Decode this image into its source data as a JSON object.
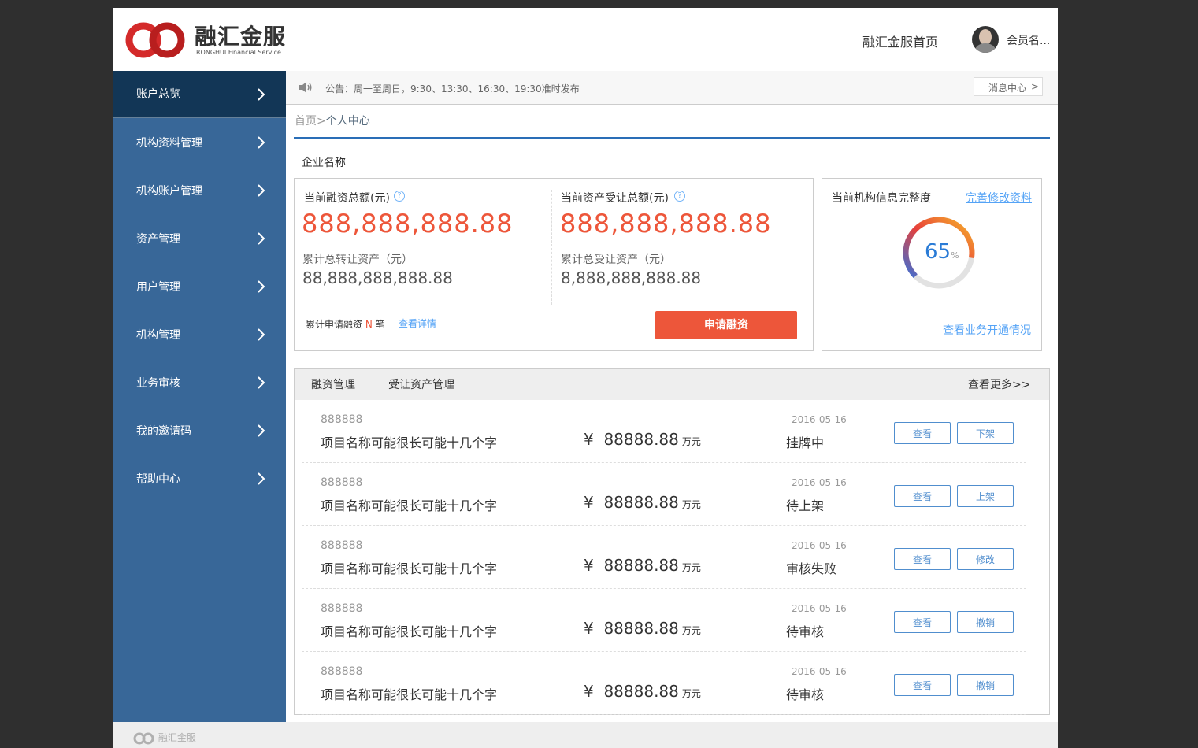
{
  "header": {
    "logo_cn": "融汇金服",
    "logo_en": "RONGHUI Financial Service",
    "home_link": "融汇金服首页",
    "username": "会员名..."
  },
  "sidebar": {
    "items": [
      {
        "label": "账户总览",
        "active": true
      },
      {
        "label": "机构资料管理"
      },
      {
        "label": "机构账户管理"
      },
      {
        "label": "资产管理"
      },
      {
        "label": "用户管理"
      },
      {
        "label": "机构管理"
      },
      {
        "label": "业务审核"
      },
      {
        "label": "我的邀请码"
      },
      {
        "label": "帮助中心"
      }
    ]
  },
  "notice": {
    "text": "公告：周一至周日，9:30、13:30、16:30、19:30准时发布",
    "message_center": "消息中心",
    "arrow": ">"
  },
  "breadcrumb": {
    "home": "首页",
    "sep": ">",
    "current": "个人中心"
  },
  "company": "企业名称",
  "summary": {
    "financing_total_label": "当前融资总额(元)",
    "financing_total_value": "888,888,888.88",
    "asset_total_label": "当前资产受让总额(元)",
    "asset_total_value": "888,888,888.88",
    "cum_transfer_label": "累计总转让资产（元）",
    "cum_transfer_value": "88,888,888,888.88",
    "cum_receive_label": "累计总受让资产（元）",
    "cum_receive_value": "8,888,888,888.88",
    "apply_count_prefix": "累计申请融资",
    "apply_count_n": "N",
    "apply_count_suffix": "笔",
    "view_detail": "查看详情",
    "apply_button": "申请融资",
    "q_mark": "?"
  },
  "completeness": {
    "title": "当前机构信息完整度",
    "edit_link": "完善修改资料",
    "percent": 65,
    "percent_text": "65",
    "percent_sign": "%",
    "business_link": "查看业务开通情况",
    "accent": "#54a3f6"
  },
  "tabs": {
    "items": [
      "融资管理",
      "受让资产管理"
    ],
    "more": "查看更多>>"
  },
  "rows": [
    {
      "code": "888888",
      "name": "项目名称可能很长可能十几个字",
      "currency": "¥",
      "amount": "88888.88",
      "unit": "万元",
      "date": "2016-05-16",
      "status": "挂牌中",
      "btn1": "查看",
      "btn2": "下架"
    },
    {
      "code": "888888",
      "name": "项目名称可能很长可能十几个字",
      "currency": "¥",
      "amount": "88888.88",
      "unit": "万元",
      "date": "2016-05-16",
      "status": "待上架",
      "btn1": "查看",
      "btn2": "上架"
    },
    {
      "code": "888888",
      "name": "项目名称可能很长可能十几个字",
      "currency": "¥",
      "amount": "88888.88",
      "unit": "万元",
      "date": "2016-05-16",
      "status": "审核失败",
      "btn1": "查看",
      "btn2": "修改"
    },
    {
      "code": "888888",
      "name": "项目名称可能很长可能十几个字",
      "currency": "¥",
      "amount": "88888.88",
      "unit": "万元",
      "date": "2016-05-16",
      "status": "待审核",
      "btn1": "查看",
      "btn2": "撤销"
    },
    {
      "code": "888888",
      "name": "项目名称可能很长可能十几个字",
      "currency": "¥",
      "amount": "88888.88",
      "unit": "万元",
      "date": "2016-05-16",
      "status": "待审核",
      "btn1": "查看",
      "btn2": "撤销"
    }
  ],
  "footer": {
    "logo_cn": "融汇金服"
  },
  "colors": {
    "sidebar_bg": "#386798",
    "sidebar_active": "#123656",
    "primary_orange": "#ed563a",
    "link_blue": "#54a3f6",
    "button_border": "#508ece",
    "divider": "#cccccc",
    "title_line": "#2a6eb7"
  }
}
